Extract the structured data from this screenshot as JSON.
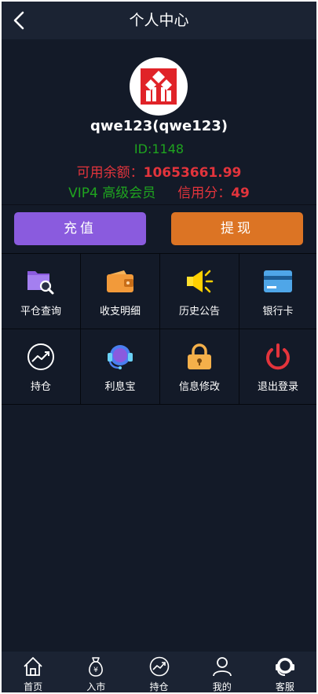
{
  "header": {
    "title": "个人中心"
  },
  "profile": {
    "username": "qwe123(qwe123)",
    "id_text": "ID:1148",
    "balance_label": "可用余额：",
    "balance_value": "10653661.99",
    "vip_text": "VIP4 高级会员",
    "credit_label": "信用分：",
    "credit_value": "49"
  },
  "actions": {
    "recharge": "充值",
    "withdraw": "提现"
  },
  "menu": {
    "items": [
      {
        "label": "平仓查询",
        "icon": "folder-search-icon"
      },
      {
        "label": "收支明细",
        "icon": "wallet-icon"
      },
      {
        "label": "历史公告",
        "icon": "speaker-icon"
      },
      {
        "label": "银行卡",
        "icon": "bank-card-icon"
      },
      {
        "label": "持仓",
        "icon": "trend-chart-icon"
      },
      {
        "label": "利息宝",
        "icon": "headset-icon"
      },
      {
        "label": "信息修改",
        "icon": "lock-icon"
      },
      {
        "label": "退出登录",
        "icon": "power-icon"
      }
    ]
  },
  "tabbar": {
    "items": [
      {
        "label": "首页",
        "icon": "home-icon"
      },
      {
        "label": "入市",
        "icon": "money-bag-icon"
      },
      {
        "label": "持仓",
        "icon": "trend-chart-icon"
      },
      {
        "label": "我的",
        "icon": "user-icon"
      },
      {
        "label": "客服",
        "icon": "headset-icon"
      }
    ]
  },
  "colors": {
    "background": "#131a28",
    "bar": "#1b2333",
    "green": "#1fa41f",
    "red": "#e3343c",
    "recharge": "#8a5bde",
    "withdraw": "#dc7424"
  }
}
